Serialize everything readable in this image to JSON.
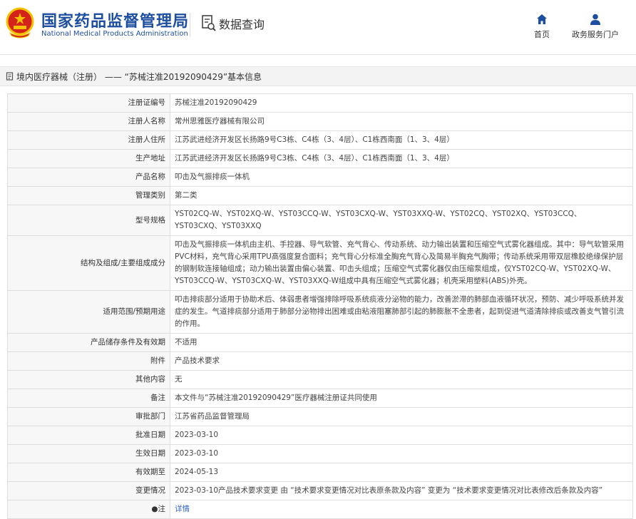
{
  "header": {
    "title_cn": "国家药品监督管理局",
    "title_en": "National Medical Products Administration",
    "query_label": "数据查询",
    "nav_home": "首页",
    "nav_portal": "政务服务门户"
  },
  "breadcrumb": "境内医疗器械（注册） —— “苏械注准20192090429”基本信息",
  "rows": [
    {
      "label": "注册证编号",
      "value": "苏械注准20192090429"
    },
    {
      "label": "注册人名称",
      "value": "常州思雅医疗器械有限公司"
    },
    {
      "label": "注册人住所",
      "value": "江苏武进经济开发区长扬路9号C3栋、C4栋（3、4层）、C1栋西南面（1、3、4层）"
    },
    {
      "label": "生产地址",
      "value": "江苏武进经济开发区长扬路9号C3栋、C4栋（3、4层）、C1栋西南面（1、3、4层）"
    },
    {
      "label": "产品名称",
      "value": "叩击及气振排痰一体机"
    },
    {
      "label": "管理类别",
      "value": "第二类"
    },
    {
      "label": "型号规格",
      "value": "YST02CQ-W、YST02XQ-W、YST03CCQ-W、YST03CXQ-W、YST03XXQ-W、YST02CQ、YST02XQ、YST03CCQ、YST03CXQ、YST03XXQ"
    },
    {
      "label": "结构及组成/主要组成成分",
      "value": "叩击及气振排痰一体机由主机、手控器、导气软管、充气背心、传动系统、动力输出装置和压缩空气式雾化器组成。其中：导气软管采用PVC材料，充气背心采用TPU高强度复合面料；充气背心分标准全胸充气背心及简易半胸充气胸带；传动系统采用带双层橡胶绝缘保护层的钢制软连接轴组成；动力输出装置由偏心装置、叩击头组成；压缩空气式雾化器仅由压缩泵组成，仅YST02CQ-W、YST02XQ-W、YST03CCQ-W、YST03CXQ-W、YST03XXQ-W组成中具有压缩空气式雾化器；机壳采用塑料(ABS)外壳。"
    },
    {
      "label": "适用范围/预期用途",
      "value": "叩击排痰部分适用于协助术后、体弱患者增强排除呼吸系统痰液分泌物的能力，改善淤滞的肺部血液循环状况，预防、减少呼吸系统并发症的发生。气道排痰部分适用于肺部分泌物排出困难或由粘液阻塞肺部引起的肺膨胀不全患者，起到促进气道清除排痰或改善支气管引流的作用。"
    },
    {
      "label": "产品储存条件及有效期",
      "value": "不适用"
    },
    {
      "label": "附件",
      "value": "产品技术要求"
    },
    {
      "label": "其他内容",
      "value": "无"
    },
    {
      "label": "备注",
      "value": "本文件与“苏械注准20192090429”医疗器械注册证共同使用"
    },
    {
      "label": "审批部门",
      "value": "江苏省药品监督管理局"
    },
    {
      "label": "批准日期",
      "value": "2023-03-10"
    },
    {
      "label": "生效日期",
      "value": "2023-03-10"
    },
    {
      "label": "有效期至",
      "value": "2024-05-13"
    },
    {
      "label": "变更情况",
      "value": "2023-03-10产品技术要求变更 由 “技术要求变更情况对比表原条款及内容” 变更为 “技术要求变更情况对比表修改后条款及内容”"
    },
    {
      "label": "注",
      "value": "详情"
    }
  ],
  "colors": {
    "brand_blue": "#1d4e9f",
    "emblem_red": "#d4231b",
    "emblem_gold": "#f5c200",
    "link_blue": "#3366cc"
  }
}
